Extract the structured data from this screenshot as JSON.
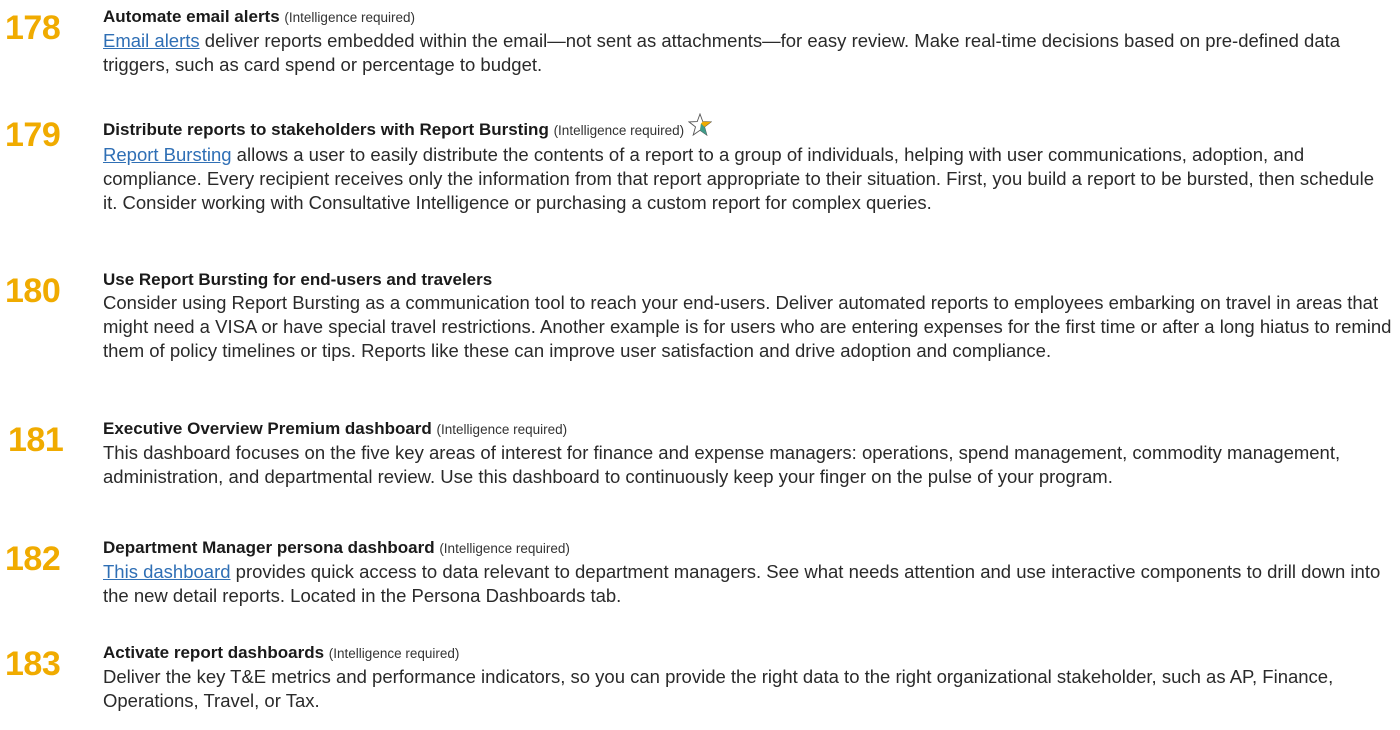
{
  "tips": [
    {
      "number": "178",
      "title": "Automate email alerts",
      "requirement": "(Intelligence required)",
      "link_text": "Email alerts",
      "body": " deliver reports embedded within the email—not sent as attachments—for easy review. Make real-time decisions based on pre-defined data triggers, such as card spend or percentage to budget."
    },
    {
      "number": "179",
      "title": "Distribute reports to stakeholders with Report Bursting",
      "requirement": "(Intelligence required)",
      "icon": "star-icon",
      "link_text": "Report Bursting",
      "body": " allows a user to easily distribute the contents of a report to a group of individuals, helping with user communications, adoption, and compliance. Every recipient receives only the information from that report appropriate to their situation. First, you build a report to be bursted, then schedule it. Consider working with Consultative Intelligence or purchasing a custom report for complex queries."
    },
    {
      "number": "180",
      "title": "Use Report Bursting for end-users and travelers",
      "body": "Consider using Report Bursting as a communication tool to reach your end-users. Deliver automated reports to employees embarking on travel in areas that might need a VISA or have special travel restrictions. Another example is for users who are entering expenses for the first time or after a long hiatus to remind them of policy timelines or tips. Reports like these can improve user satisfaction and drive adoption and compliance."
    },
    {
      "number": "181",
      "title": "Executive Overview Premium dashboard",
      "requirement": "(Intelligence required)",
      "body": "This dashboard focuses on the five key areas of interest for finance and expense managers: operations, spend management, commodity management, administration, and departmental review. Use this dashboard to continuously keep your finger on the pulse of your program."
    },
    {
      "number": "182",
      "title": "Department Manager persona dashboard",
      "requirement": "(Intelligence required)",
      "link_text": "This dashboard",
      "body": " provides quick access to data relevant to department managers. See what needs attention and use interactive components to drill down into the new detail reports. Located in the Persona Dashboards tab."
    },
    {
      "number": "183",
      "title": "Activate report dashboards",
      "requirement": "(Intelligence required)",
      "body": "Deliver the key T&E metrics and performance indicators, so you can provide the right data to the right organizational stakeholder, such as AP, Finance, Operations, Travel, or Tax."
    }
  ],
  "colors": {
    "number": "#f0ab00",
    "link": "#2f6fb5",
    "star_outline": "#555555",
    "star_fill_gold": "#f0ab00",
    "star_fill_teal": "#3f9c8a"
  }
}
